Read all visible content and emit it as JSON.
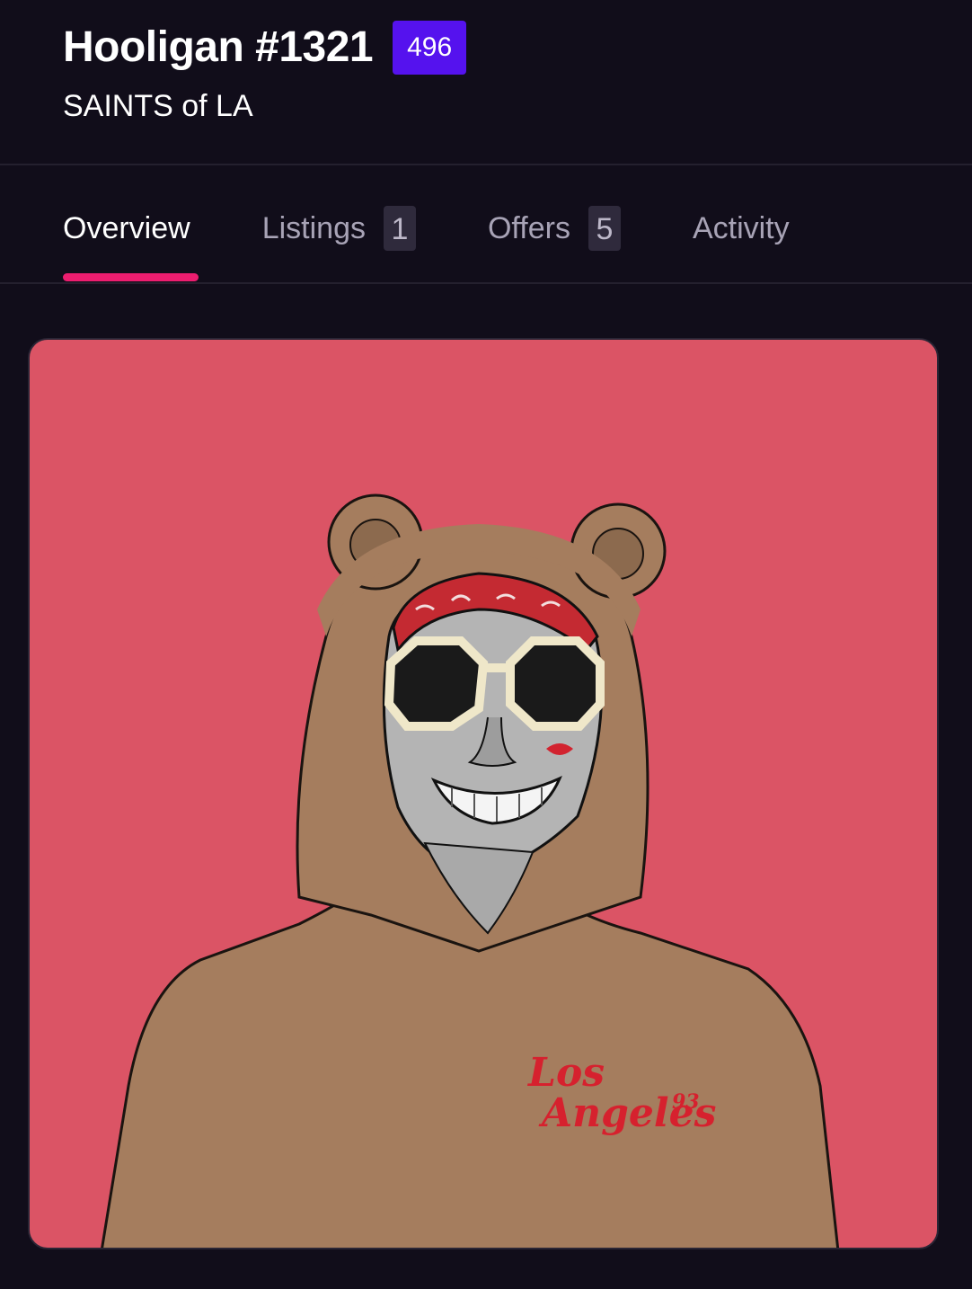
{
  "header": {
    "title": "Hooligan #1321",
    "rank_badge": "496",
    "collection": "SAINTS of LA"
  },
  "tabs": [
    {
      "label": "Overview",
      "active": true
    },
    {
      "label": "Listings",
      "count": "1"
    },
    {
      "label": "Offers",
      "count": "5"
    },
    {
      "label": "Activity"
    }
  ],
  "artwork": {
    "shirt_text_line1": "Los",
    "shirt_text_line2": "Angeles",
    "shirt_text_number": "93"
  },
  "colors": {
    "background": "#110d1a",
    "rank_badge": "#5512ee",
    "active_tab_underline": "#ec1d6f",
    "artwork_background": "#db5465",
    "hoodie": "#a57d5e"
  }
}
